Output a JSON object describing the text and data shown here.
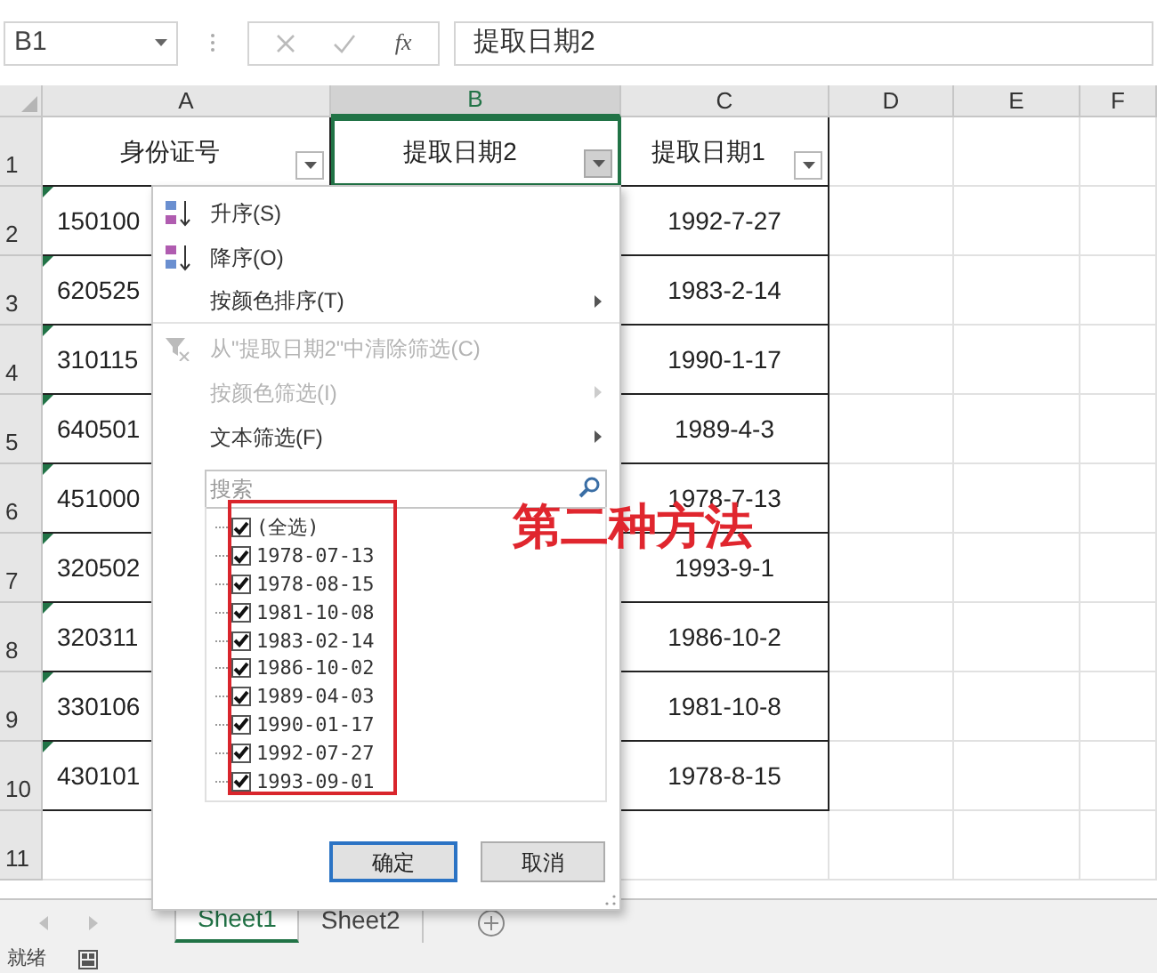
{
  "name_box": {
    "value": "B1"
  },
  "formula_bar": {
    "function_label": "fx",
    "value": "提取日期2"
  },
  "columns": [
    {
      "label": "A",
      "selected": false
    },
    {
      "label": "B",
      "selected": true
    },
    {
      "label": "C",
      "selected": false
    },
    {
      "label": "D",
      "selected": false
    },
    {
      "label": "E",
      "selected": false
    },
    {
      "label": "F",
      "selected": false
    }
  ],
  "header_row": {
    "number": "1",
    "cells": [
      {
        "text": "身份证号",
        "selected": false,
        "filter_active": false
      },
      {
        "text": "提取日期2",
        "selected": true,
        "filter_active": true
      },
      {
        "text": "提取日期1",
        "selected": false,
        "filter_active": false
      }
    ]
  },
  "data_rows": [
    {
      "number": "2",
      "id": "150100",
      "date": "1992-7-27"
    },
    {
      "number": "3",
      "id": "620525",
      "date": "1983-2-14"
    },
    {
      "number": "4",
      "id": "310115",
      "date": "1990-1-17"
    },
    {
      "number": "5",
      "id": "640501",
      "date": "1989-4-3"
    },
    {
      "number": "6",
      "id": "451000",
      "date": "1978-7-13"
    },
    {
      "number": "7",
      "id": "320502",
      "date": "1993-9-1"
    },
    {
      "number": "8",
      "id": "320311",
      "date": "1986-10-2"
    },
    {
      "number": "9",
      "id": "330106",
      "date": "1981-10-8"
    },
    {
      "number": "10",
      "id": "430101",
      "date": "1978-8-15"
    }
  ],
  "empty_rows": [
    {
      "number": "11"
    }
  ],
  "filter_menu": {
    "items": [
      {
        "kind": "sort_asc",
        "label": "升序(S)",
        "disabled": false,
        "submenu": false,
        "separator_after": false
      },
      {
        "kind": "sort_desc",
        "label": "降序(O)",
        "disabled": false,
        "submenu": false,
        "separator_after": false
      },
      {
        "kind": "plain",
        "label": "按颜色排序(T)",
        "disabled": false,
        "submenu": true,
        "separator_after": true
      },
      {
        "kind": "clear_filter",
        "label": "从\"提取日期2\"中清除筛选(C)",
        "disabled": true,
        "submenu": false,
        "separator_after": false
      },
      {
        "kind": "plain",
        "label": "按颜色筛选(I)",
        "disabled": true,
        "submenu": true,
        "separator_after": false
      },
      {
        "kind": "plain",
        "label": "文本筛选(F)",
        "disabled": false,
        "submenu": true,
        "separator_after": false
      }
    ],
    "search": {
      "placeholder": "搜索"
    },
    "options": [
      {
        "label": "(全选)",
        "checked": true
      },
      {
        "label": "1978-07-13",
        "checked": true
      },
      {
        "label": "1978-08-15",
        "checked": true
      },
      {
        "label": "1981-10-08",
        "checked": true
      },
      {
        "label": "1983-02-14",
        "checked": true
      },
      {
        "label": "1986-10-02",
        "checked": true
      },
      {
        "label": "1989-04-03",
        "checked": true
      },
      {
        "label": "1990-01-17",
        "checked": true
      },
      {
        "label": "1992-07-27",
        "checked": true
      },
      {
        "label": "1993-09-01",
        "checked": true
      }
    ],
    "buttons": [
      {
        "label": "确定",
        "selected": true
      },
      {
        "label": "取消",
        "selected": false
      }
    ]
  },
  "annotation": {
    "text": "第二种方法"
  },
  "sheet_tabs": [
    {
      "label": "Sheet1",
      "selected": true
    },
    {
      "label": "Sheet2",
      "selected": false
    }
  ],
  "status_bar": {
    "text": "就绪"
  }
}
